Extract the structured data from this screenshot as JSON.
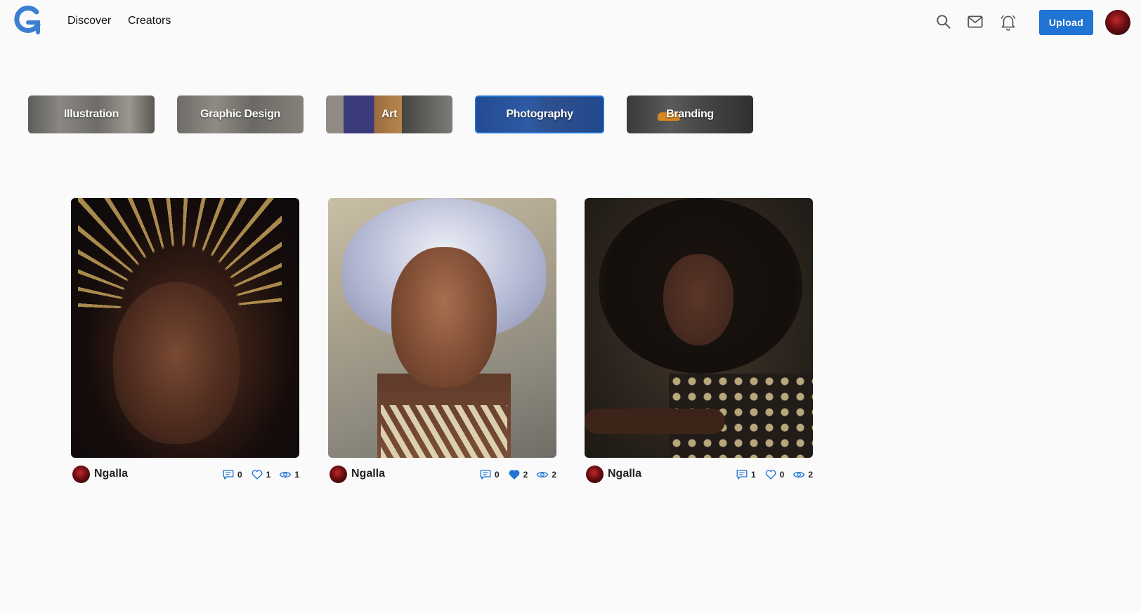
{
  "header": {
    "nav": {
      "discover": "Discover",
      "creators": "Creators"
    },
    "upload_label": "Upload",
    "accent": "#1f74d4",
    "icons": [
      "search-icon",
      "mail-icon",
      "bell-icon"
    ]
  },
  "categories": [
    {
      "label": "Illustration",
      "active": false
    },
    {
      "label": "Graphic Design",
      "active": false
    },
    {
      "label": "Art",
      "active": false
    },
    {
      "label": "Photography",
      "active": true
    },
    {
      "label": "Branding",
      "active": false
    }
  ],
  "cards": [
    {
      "author": "Ngalla",
      "comments": "0",
      "likes": "1",
      "views": "1",
      "liked": false
    },
    {
      "author": "Ngalla",
      "comments": "0",
      "likes": "2",
      "views": "2",
      "liked": true
    },
    {
      "author": "Ngalla",
      "comments": "1",
      "likes": "0",
      "views": "2",
      "liked": false
    }
  ]
}
